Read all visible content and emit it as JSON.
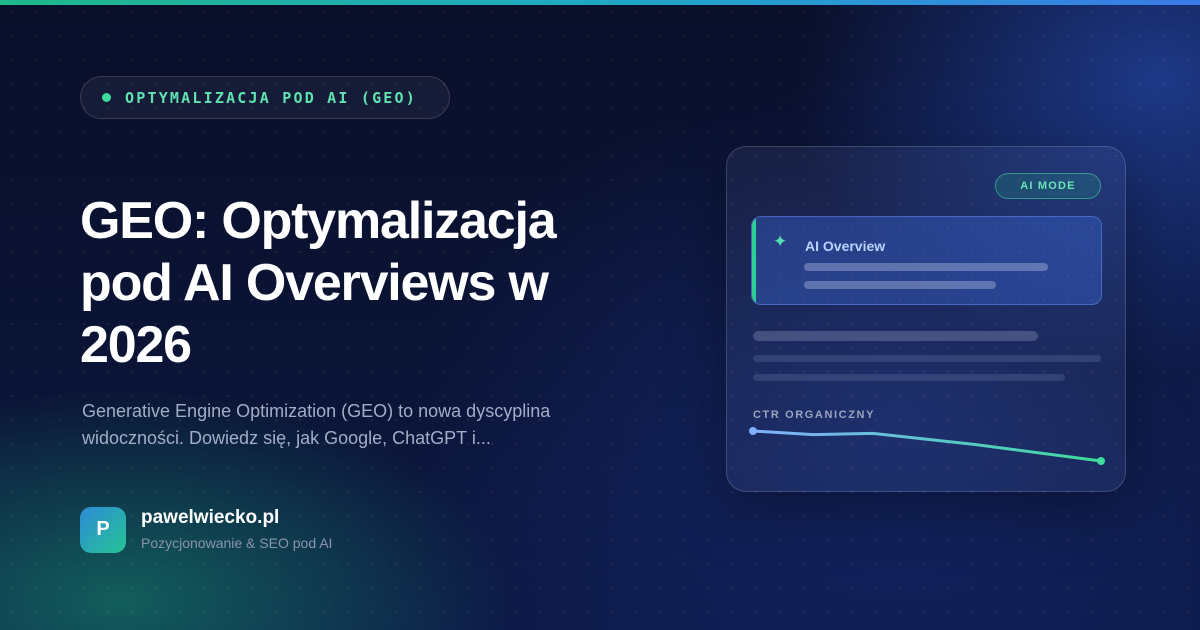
{
  "badge": {
    "label": "OPTYMALIZACJA POD AI (GEO)"
  },
  "headline": "GEO: Optymalizacja pod AI Overviews w 2026",
  "subtitle": "Generative Engine Optimization (GEO) to nowa dyscyplina widoczności. Dowiedz się, jak Google, ChatGPT i...",
  "brand": {
    "logo_letter": "P",
    "name": "pawelwiecko.pl",
    "tagline": "Pozycjonowanie & SEO pod AI"
  },
  "card": {
    "mode_badge": "AI MODE",
    "overview": {
      "icon": "sparkle-icon",
      "title": "AI Overview"
    },
    "ctr_label": "CTR ORGANICZNY",
    "ctr_trend": [
      1.0,
      0.88,
      0.92,
      0.55,
      0.0
    ]
  },
  "colors": {
    "accent_green": "#3ddc9a",
    "accent_blue": "#7fb0ff",
    "background": "#0b1436"
  }
}
